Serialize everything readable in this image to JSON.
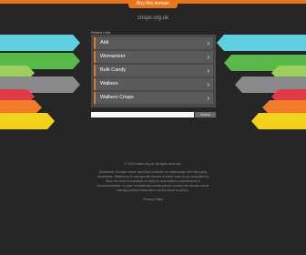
{
  "header": {
    "buy_label": "Buy this domain",
    "domain": "crisps.org.uk"
  },
  "colors": {
    "accent": "#e8771a",
    "background": "#262626",
    "arrows": [
      "#5ed0e0",
      "#56b948",
      "#9bd05a",
      "#8a8a8a",
      "#e03a4a",
      "#f07c2c",
      "#f2d21a"
    ]
  },
  "related": {
    "label": "Related Links",
    "links": [
      {
        "label": "Aldi"
      },
      {
        "label": "Womanizer"
      },
      {
        "label": "Bulk Candy"
      },
      {
        "label": "Walkers"
      },
      {
        "label": "Walkers Crisps"
      }
    ]
  },
  "search": {
    "placeholder": "",
    "button_label": "Search"
  },
  "footer": {
    "lines": [
      "© 2024 crisps.org.uk. All rights reserved.",
      "Disclaimer: Domain owner and Sedo maintain no relationship with third party",
      "advertisers. Reference to any specific service or trade mark is not controlled by",
      "Sedo nor does it constitute or imply its association, endorsement or",
      "recommendation. In case of trademark issues please contact the domain owner",
      "directly (contact information can be found in whois)."
    ],
    "privacy": "Privacy Policy"
  }
}
